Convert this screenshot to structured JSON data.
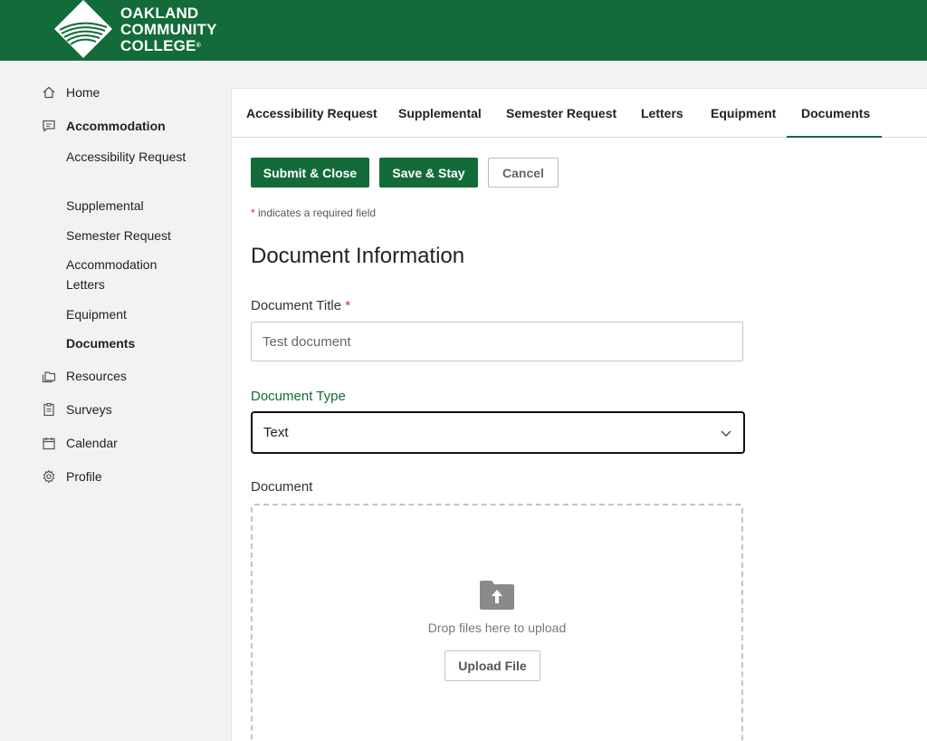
{
  "header": {
    "logo_lines": [
      "OAKLAND",
      "COMMUNITY",
      "COLLEGE"
    ],
    "registered_mark": "®",
    "brand_color": "#146b3a"
  },
  "sidebar": {
    "items": [
      {
        "label": "Home",
        "icon": "home-icon"
      },
      {
        "label": "Accommodation",
        "icon": "chat-icon"
      },
      {
        "label": "Resources",
        "icon": "folders-icon"
      },
      {
        "label": "Surveys",
        "icon": "clipboard-icon"
      },
      {
        "label": "Calendar",
        "icon": "calendar-icon"
      },
      {
        "label": "Profile",
        "icon": "gear-icon"
      }
    ],
    "sub_items": [
      {
        "label": "Accessibility Request"
      },
      {
        "label": "Supplemental"
      },
      {
        "label": "Semester Request"
      },
      {
        "label": "Accommodation Letters"
      },
      {
        "label": "Equipment"
      },
      {
        "label": "Documents"
      }
    ]
  },
  "tabs": [
    {
      "label": "Accessibility Request"
    },
    {
      "label": "Supplemental"
    },
    {
      "label": "Semester Request"
    },
    {
      "label": "Letters"
    },
    {
      "label": "Equipment"
    },
    {
      "label": "Documents",
      "active": true
    }
  ],
  "actions": {
    "submit_close": "Submit & Close",
    "save_stay": "Save & Stay",
    "cancel": "Cancel"
  },
  "form": {
    "required_star": "*",
    "required_note": " indicates a required field",
    "section_title": "Document Information",
    "title_label": "Document Title",
    "title_value": "Test document",
    "type_label": "Document Type",
    "type_value": "Text",
    "document_label": "Document",
    "drop_text": "Drop files here to upload",
    "upload_button": "Upload File"
  }
}
